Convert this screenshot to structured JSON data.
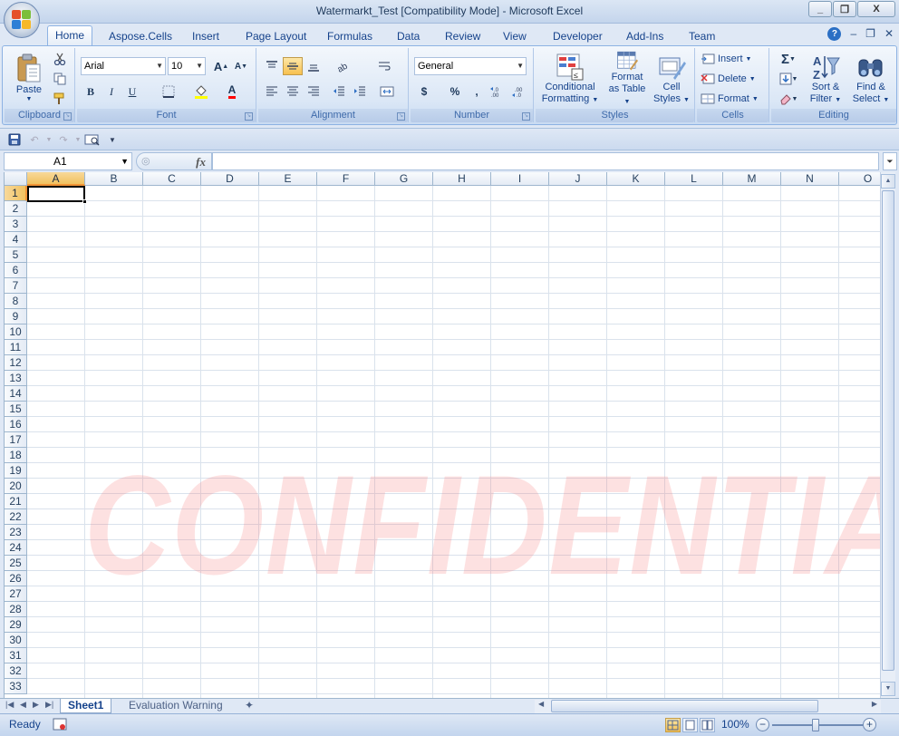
{
  "window": {
    "title": "Watermarkt_Test  [Compatibility Mode] - Microsoft Excel",
    "minimize": "_",
    "restore": "❐",
    "close": "X"
  },
  "ribbon_tabs": [
    {
      "label": "Home",
      "active": true
    },
    {
      "label": "Aspose.Cells"
    },
    {
      "label": "Insert"
    },
    {
      "label": "Page Layout"
    },
    {
      "label": "Formulas"
    },
    {
      "label": "Data"
    },
    {
      "label": "Review"
    },
    {
      "label": "View"
    },
    {
      "label": "Developer"
    },
    {
      "label": "Add-Ins"
    },
    {
      "label": "Team"
    }
  ],
  "groups": {
    "clipboard": {
      "label": "Clipboard",
      "paste": "Paste"
    },
    "font": {
      "label": "Font",
      "font_name": "Arial",
      "font_size": "10",
      "bold": "B",
      "italic": "I",
      "underline": "U",
      "grow": "A",
      "shrink": "A",
      "font_color": "A"
    },
    "alignment": {
      "label": "Alignment"
    },
    "number": {
      "label": "Number",
      "format": "General",
      "currency": "$",
      "percent": "%",
      "comma": ","
    },
    "styles": {
      "label": "Styles",
      "conditional_formatting": [
        "Conditional",
        "Formatting"
      ],
      "format_as_table": [
        "Format",
        "as Table"
      ],
      "cell_styles": [
        "Cell",
        "Styles"
      ]
    },
    "cells": {
      "label": "Cells",
      "insert": "Insert",
      "delete": "Delete",
      "format": "Format"
    },
    "editing": {
      "label": "Editing",
      "sum": "Σ",
      "sort_filter": [
        "Sort &",
        "Filter"
      ],
      "find_select": [
        "Find &",
        "Select"
      ]
    }
  },
  "formula_bar": {
    "name_box": "A1",
    "fx": "fx",
    "formula": ""
  },
  "columns": [
    "A",
    "B",
    "C",
    "D",
    "E",
    "F",
    "G",
    "H",
    "I",
    "J",
    "K",
    "L",
    "M",
    "N",
    "O"
  ],
  "rows": [
    "1",
    "2",
    "3",
    "4",
    "5",
    "6",
    "7",
    "8",
    "9",
    "10",
    "11",
    "12",
    "13",
    "14",
    "15",
    "16",
    "17",
    "18",
    "19",
    "20",
    "21",
    "22",
    "23",
    "24",
    "25",
    "26",
    "27",
    "28",
    "29",
    "30",
    "31",
    "32",
    "33"
  ],
  "selected_cell": {
    "column": "A",
    "row": "1"
  },
  "watermark": "CONFIDENTIAL",
  "sheets": [
    {
      "label": "Sheet1",
      "active": true
    },
    {
      "label": "Evaluation Warning"
    }
  ],
  "status": {
    "ready": "Ready",
    "zoom": "100%",
    "zoom_out": "−",
    "zoom_in": "+"
  },
  "colors": {
    "accent": "#15428b",
    "watermark": "#f57878",
    "selected_header": "#f1c15f"
  }
}
